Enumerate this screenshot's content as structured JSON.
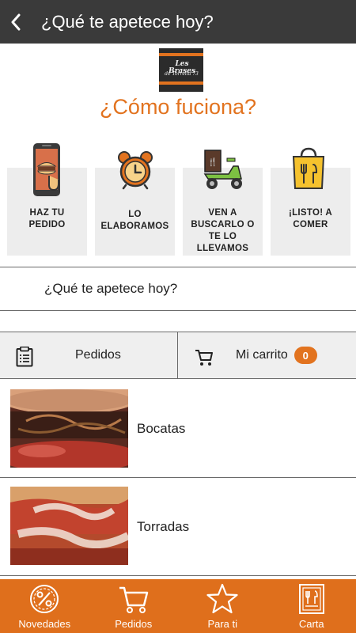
{
  "header": {
    "title": "¿Qué te apetece hoy?"
  },
  "logo": {
    "line1": "Les Brases",
    "line2": "de Torrella 73"
  },
  "how_it_works": {
    "title": "¿Cómo fuciona?",
    "steps": [
      {
        "label": "HAZ TU PEDIDO",
        "icon": "phone-order-icon"
      },
      {
        "label": "LO ELABORAMOS",
        "icon": "alarm-clock-icon"
      },
      {
        "label": "VEN A BUSCARLO O TE LO LLEVAMOS",
        "icon": "delivery-scooter-icon"
      },
      {
        "label": "¡LISTO! A COMER",
        "icon": "food-bag-icon"
      }
    ]
  },
  "search": {
    "text": "¿Qué te apetece hoy?"
  },
  "actions": {
    "orders_label": "Pedidos",
    "cart_label": "Mi carrito",
    "cart_count": "0"
  },
  "categories": [
    {
      "label": "Bocatas",
      "image": "sandwich-photo"
    },
    {
      "label": "Torradas",
      "image": "toast-photo"
    }
  ],
  "bottom_nav": [
    {
      "label": "Novedades",
      "icon": "percent-badge-icon"
    },
    {
      "label": "Pedidos",
      "icon": "cart-icon"
    },
    {
      "label": "Para ti",
      "icon": "star-icon"
    },
    {
      "label": "Carta",
      "icon": "menu-card-icon"
    }
  ],
  "colors": {
    "accent": "#e2731f",
    "topbar": "#3a3a3a",
    "step_bg": "#ededed"
  }
}
